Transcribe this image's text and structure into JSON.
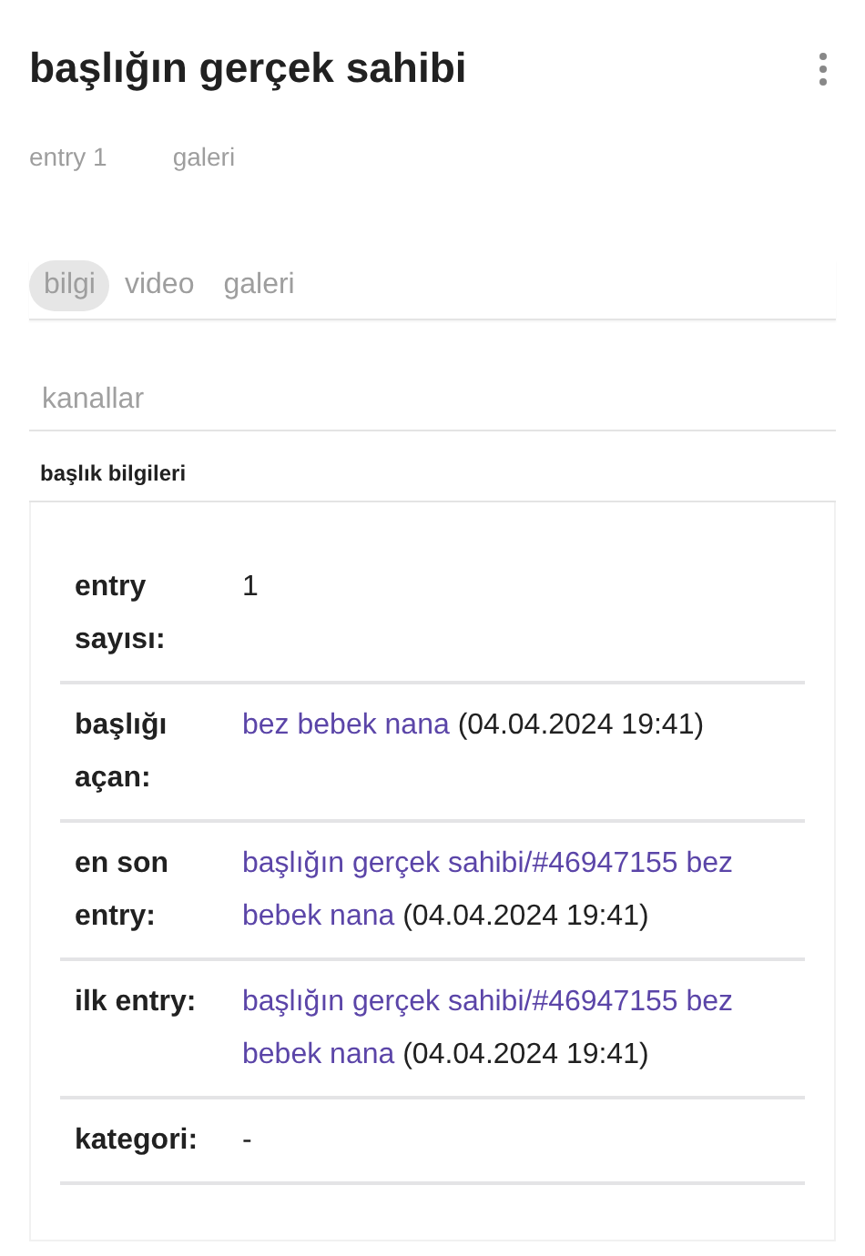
{
  "title": "başlığın gerçek sahibi",
  "meta": [
    "entry 1",
    "galeri"
  ],
  "tabs": [
    {
      "label": "bilgi",
      "selected": true
    },
    {
      "label": "video",
      "selected": false
    },
    {
      "label": "galeri",
      "selected": false
    }
  ],
  "channels": {
    "label": "kanallar"
  },
  "info": {
    "heading": "başlık bilgileri",
    "rows": [
      {
        "label": "entry sayısı:",
        "link": "",
        "text": "1"
      },
      {
        "label": "başlığı açan:",
        "link": "bez bebek nana",
        "text": "(04.04.2024 19:41)"
      },
      {
        "label": "en son entry:",
        "link": "başlığın gerçek sahibi/#46947155 bez bebek nana",
        "text": "(04.04.2024 19:41)"
      },
      {
        "label": "ilk entry:",
        "link": "başlığın gerçek sahibi/#46947155 bez bebek nana",
        "text": "(04.04.2024 19:41)"
      },
      {
        "label": "kategori:",
        "link": "",
        "text": "-"
      }
    ]
  }
}
